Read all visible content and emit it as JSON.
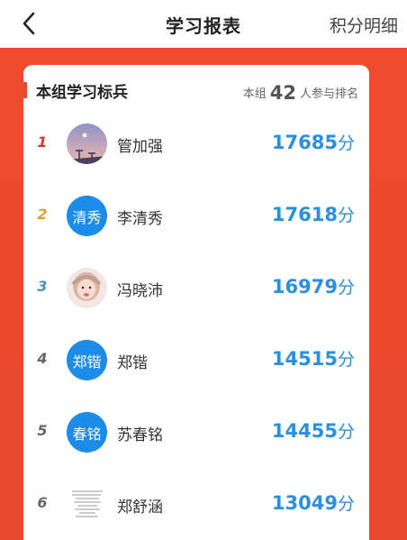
{
  "header": {
    "title": "学习报表",
    "detail_link": "积分明细"
  },
  "card": {
    "title": "本组学习标兵",
    "participants_prefix": "本组",
    "participants_count": "42",
    "participants_suffix": "人参与排名"
  },
  "colors": {
    "brand_red": "#e8462e",
    "score_blue": "#2b8fe0",
    "avatar_blue": "#1b8ce8",
    "rank_1": "#d43b2b",
    "rank_2": "#e0a030",
    "rank_3": "#4a90c8",
    "rank_other": "#666666"
  },
  "ranking": [
    {
      "rank": "1",
      "name": "管加强",
      "score": "17685",
      "unit": "分",
      "avatar_text": ""
    },
    {
      "rank": "2",
      "name": "李清秀",
      "score": "17618",
      "unit": "分",
      "avatar_text": "清秀"
    },
    {
      "rank": "3",
      "name": "冯晓沛",
      "score": "16979",
      "unit": "分",
      "avatar_text": ""
    },
    {
      "rank": "4",
      "name": "郑锴",
      "score": "14515",
      "unit": "分",
      "avatar_text": "郑锴"
    },
    {
      "rank": "5",
      "name": "苏春铭",
      "score": "14455",
      "unit": "分",
      "avatar_text": "春铭"
    },
    {
      "rank": "6",
      "name": "郑舒涵",
      "score": "13049",
      "unit": "分",
      "avatar_text": ""
    }
  ]
}
